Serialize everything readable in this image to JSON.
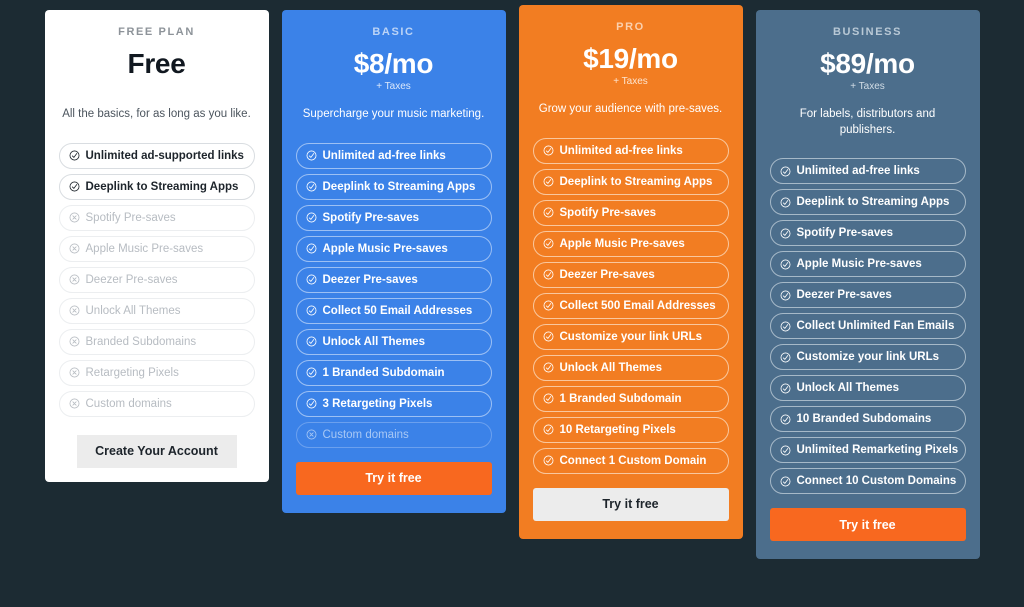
{
  "page": {
    "background_color": "#1c2b33"
  },
  "icons": {
    "included": "check-circle-icon",
    "excluded": "x-circle-icon"
  },
  "plans": [
    {
      "id": "free",
      "name": "FREE PLAN",
      "price": "Free",
      "taxes": "",
      "tagline": "All the basics, for as long as you like.",
      "accent_color": "#ffffff",
      "cta_label": "Create Your Account",
      "cta_style": "ghost",
      "features": [
        {
          "label": "Unlimited ad-supported links",
          "included": true
        },
        {
          "label": "Deeplink to Streaming Apps",
          "included": true
        },
        {
          "label": "Spotify Pre-saves",
          "included": false
        },
        {
          "label": "Apple Music Pre-saves",
          "included": false
        },
        {
          "label": "Deezer Pre-saves",
          "included": false
        },
        {
          "label": "Unlock All Themes",
          "included": false
        },
        {
          "label": "Branded Subdomains",
          "included": false
        },
        {
          "label": "Retargeting Pixels",
          "included": false
        },
        {
          "label": "Custom domains",
          "included": false
        }
      ]
    },
    {
      "id": "basic",
      "name": "BASIC",
      "price": "$8/mo",
      "taxes": "+ Taxes",
      "tagline": "Supercharge your music marketing.",
      "accent_color": "#3b82e8",
      "cta_label": "Try it free",
      "cta_style": "orange",
      "features": [
        {
          "label": "Unlimited ad-free links",
          "included": true
        },
        {
          "label": "Deeplink to Streaming Apps",
          "included": true
        },
        {
          "label": "Spotify Pre-saves",
          "included": true
        },
        {
          "label": "Apple Music Pre-saves",
          "included": true
        },
        {
          "label": "Deezer Pre-saves",
          "included": true
        },
        {
          "label": "Collect 50 Email Addresses",
          "included": true
        },
        {
          "label": "Unlock All Themes",
          "included": true
        },
        {
          "label": "1 Branded Subdomain",
          "included": true
        },
        {
          "label": "3 Retargeting Pixels",
          "included": true
        },
        {
          "label": "Custom domains",
          "included": false
        }
      ]
    },
    {
      "id": "pro",
      "name": "PRO",
      "price": "$19/mo",
      "taxes": "+ Taxes",
      "tagline": "Grow your audience with pre-saves.",
      "accent_color": "#f27d22",
      "cta_label": "Try it free",
      "cta_style": "light",
      "features": [
        {
          "label": "Unlimited ad-free links",
          "included": true
        },
        {
          "label": "Deeplink to Streaming Apps",
          "included": true
        },
        {
          "label": "Spotify Pre-saves",
          "included": true
        },
        {
          "label": "Apple Music Pre-saves",
          "included": true
        },
        {
          "label": "Deezer Pre-saves",
          "included": true
        },
        {
          "label": "Collect 500 Email Addresses",
          "included": true
        },
        {
          "label": "Customize your link URLs",
          "included": true
        },
        {
          "label": "Unlock All Themes",
          "included": true
        },
        {
          "label": "1 Branded Subdomain",
          "included": true
        },
        {
          "label": "10 Retargeting Pixels",
          "included": true
        },
        {
          "label": "Connect 1 Custom Domain",
          "included": true
        }
      ]
    },
    {
      "id": "business",
      "name": "BUSINESS",
      "price": "$89/mo",
      "taxes": "+ Taxes",
      "tagline": "For labels, distributors and publishers.",
      "accent_color": "#4c6e8c",
      "cta_label": "Try it free",
      "cta_style": "orange",
      "features": [
        {
          "label": "Unlimited ad-free links",
          "included": true
        },
        {
          "label": "Deeplink to Streaming Apps",
          "included": true
        },
        {
          "label": "Spotify Pre-saves",
          "included": true
        },
        {
          "label": "Apple Music Pre-saves",
          "included": true
        },
        {
          "label": "Deezer Pre-saves",
          "included": true
        },
        {
          "label": "Collect Unlimited Fan Emails",
          "included": true
        },
        {
          "label": "Customize your link URLs",
          "included": true
        },
        {
          "label": "Unlock All Themes",
          "included": true
        },
        {
          "label": "10 Branded Subdomains",
          "included": true
        },
        {
          "label": "Unlimited Remarketing Pixels",
          "included": true
        },
        {
          "label": "Connect 10 Custom Domains",
          "included": true
        }
      ]
    }
  ]
}
